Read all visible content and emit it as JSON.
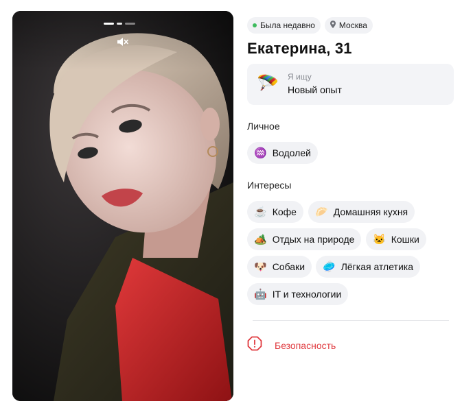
{
  "photo": {
    "alt": "Фото профиля",
    "story_count": 3,
    "active_story": 1
  },
  "status": {
    "online": "Была недавно",
    "city": "Москва"
  },
  "profile": {
    "name_age": "Екатерина, 31"
  },
  "looking_for": {
    "label": "Я ищу",
    "value": "Новый опыт",
    "emoji": "🪂"
  },
  "sections": {
    "personal_title": "Личное",
    "personal": [
      {
        "icon": "♒",
        "label": "Водолей"
      }
    ],
    "interests_title": "Интересы",
    "interests": [
      {
        "icon": "☕",
        "label": "Кофе"
      },
      {
        "icon": "🥟",
        "label": "Домашняя кухня"
      },
      {
        "icon": "🏕️",
        "label": "Отдых на природе"
      },
      {
        "icon": "🐱",
        "label": "Кошки"
      },
      {
        "icon": "🐶",
        "label": "Собаки"
      },
      {
        "icon": "🥏",
        "label": "Лёгкая атлетика"
      },
      {
        "icon": "🤖",
        "label": "IT и технологии"
      }
    ]
  },
  "safety": {
    "label": "Безопасность",
    "color": "#e0393e"
  },
  "colors": {
    "online_dot": "#3dbb5d",
    "chip_bg": "#f1f2f5"
  }
}
